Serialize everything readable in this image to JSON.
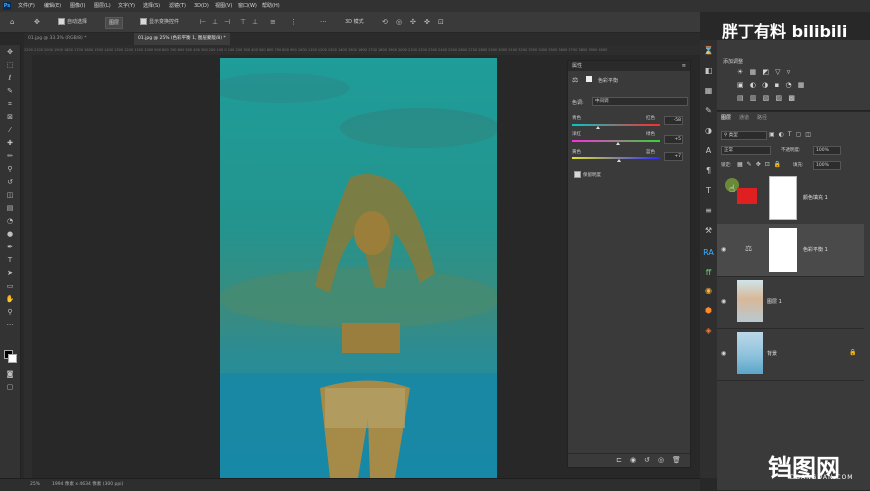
{
  "app": {
    "logo": "Ps",
    "menus": [
      "文件(F)",
      "编辑(E)",
      "图像(I)",
      "图层(L)",
      "文字(Y)",
      "选择(S)",
      "滤镜(T)",
      "3D(D)",
      "视图(V)",
      "窗口(W)",
      "帮助(H)"
    ]
  },
  "options_bar": {
    "auto_select_label": "自动选择",
    "auto_select_target": "图层",
    "transform_label": "显示变换控件",
    "mode_label": "3D 模式"
  },
  "tabs": [
    {
      "label": "01.jpg @ 33.3% (RGB/8) *",
      "active": false
    },
    {
      "label": "01.jpg @ 25% (色彩平衡 1, 图层蒙版/8) *",
      "active": true
    }
  ],
  "ruler_text": "2200 2100 2000 1900 1800 1700 1600 1500 1400 1300 1200 1100 1000 900 800 700 600 500 400 300 200 100 0 100 200 300 400 500 600 700 800 900 1000 1100 1200 1300 1400 1500 1600 1700 1800 1900 2000 2100 2200 2300 2400 2500 2600 2700 2800 2900 3000 3100 3200 3300 3400 3500 3600 3700 3800 3900 4000",
  "status": {
    "zoom": "25%",
    "doc_info": "1994 像素 x 4634 像素 (300 ppi)"
  },
  "properties": {
    "header": "属性",
    "title": "色彩平衡",
    "tone_label": "色调:",
    "tone_value": "中间调",
    "sliders": [
      {
        "left": "青色",
        "right": "红色",
        "value": "-58",
        "fraction": 0.3,
        "colors": [
          "#00c8c8",
          "#ff2a2a"
        ]
      },
      {
        "left": "洋红",
        "right": "绿色",
        "value": "+5",
        "fraction": 0.52,
        "colors": [
          "#ff2adf",
          "#34d534"
        ]
      },
      {
        "left": "黄色",
        "right": "蓝色",
        "value": "+7",
        "fraction": 0.53,
        "colors": [
          "#e2e22a",
          "#2a2aff"
        ]
      }
    ],
    "preserve_label": "保留明度",
    "preserve_checked": true
  },
  "adjustments": {
    "header": "添加调整",
    "rows": [
      "☀ ▦ ◩ ▽ ▿",
      "▣ ◐ ◑ ▪ ◔ ▦",
      "▤ ▥ ▧ ▨ ▩"
    ]
  },
  "layers": {
    "tabs": [
      "图层",
      "通道",
      "路径"
    ],
    "kind_label": "类型",
    "blend_mode": "正常",
    "opacity_label": "不透明度:",
    "opacity": "100%",
    "lock_label": "锁定:",
    "fill_label": "填充:",
    "fill": "100%",
    "items": [
      {
        "name": "颜色填充 1",
        "visible": false
      },
      {
        "name": "色彩平衡 1",
        "visible": true
      },
      {
        "name": "图层 1",
        "visible": true
      },
      {
        "name": "背景",
        "visible": true
      }
    ]
  },
  "watermark": {
    "top": "胖丁有料 bilibili",
    "bottom": "铛图网",
    "bottom_sub": "DDANGDAN.COM"
  }
}
